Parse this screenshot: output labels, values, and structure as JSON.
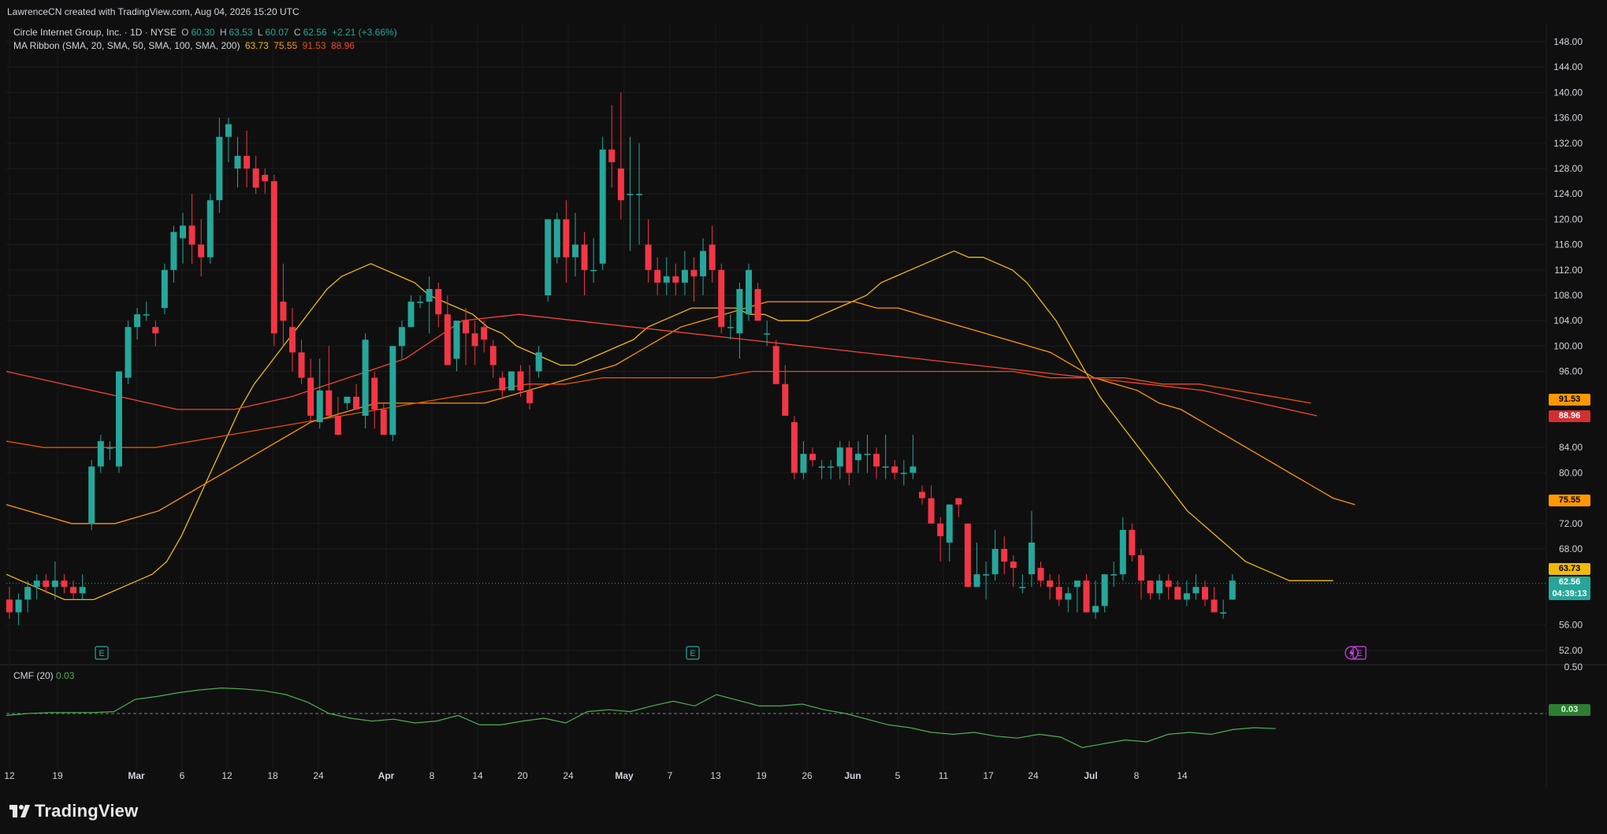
{
  "header": {
    "credit": "LawrenceCN created with TradingView.com, Aug 04, 2026 15:20 UTC"
  },
  "symbol_legend": {
    "name": "Circle Internet Group, Inc. · 1D · NYSE",
    "open_label": "O",
    "open": "60.30",
    "high_label": "H",
    "high": "63.53",
    "low_label": "L",
    "low": "60.07",
    "close_label": "C",
    "close": "62.56",
    "change": "+2.21 (+3.66%)"
  },
  "ma_legend": {
    "name": "MA Ribbon (SMA, 20, SMA, 50, SMA, 100, SMA, 200)",
    "values": [
      "63.73",
      "75.55",
      "91.53",
      "88.96"
    ]
  },
  "cmf_legend": {
    "name": "CMF (20)",
    "value": "0.03"
  },
  "price_axis": {
    "ticks": [
      "148.00",
      "144.00",
      "140.00",
      "136.00",
      "132.00",
      "128.00",
      "124.00",
      "120.00",
      "116.00",
      "112.00",
      "108.00",
      "104.00",
      "100.00",
      "96.00",
      "84.00",
      "80.00",
      "72.00",
      "68.00",
      "56.00",
      "52.00"
    ],
    "cmf_tick": "0.50"
  },
  "price_labels": {
    "ma200": "91.53",
    "ma100": "88.96",
    "ma50": "75.55",
    "ma20": "63.73",
    "last": "62.56",
    "countdown": "04:39:13",
    "cmf": "0.03"
  },
  "time_axis": [
    "12",
    "19",
    "Mar",
    "6",
    "12",
    "18",
    "24",
    "Apr",
    "8",
    "14",
    "20",
    "24",
    "May",
    "7",
    "13",
    "19",
    "26",
    "Jun",
    "5",
    "11",
    "17",
    "24",
    "Jul",
    "8",
    "14"
  ],
  "earnings_markers": [
    "E",
    "E",
    "E"
  ],
  "brand": {
    "logo_text": "TradingView"
  },
  "colors": {
    "background": "#0f0f0f",
    "up": "#26a69a",
    "down": "#f23645",
    "ma20": "#f0b90b",
    "ma50": "#ff9800",
    "ma100": "#e65100",
    "ma200": "#f44336",
    "cmf_line": "#4caf50"
  },
  "chart_data": [
    {
      "type": "candlestick",
      "title": "Circle Internet Group, Inc. · 1D · NYSE",
      "ylim": [
        50,
        150
      ],
      "xlabel": "",
      "ylabel": "",
      "grid": true,
      "date_ticks": [
        "12",
        "19",
        "Mar",
        "6",
        "12",
        "18",
        "24",
        "Apr",
        "8",
        "14",
        "20",
        "24",
        "May",
        "7",
        "13",
        "19",
        "26",
        "Jun",
        "5",
        "11",
        "17",
        "24",
        "Jul",
        "8",
        "14"
      ],
      "candles": [
        [
          60,
          62,
          57,
          58
        ],
        [
          58,
          61,
          56,
          60
        ],
        [
          60,
          63,
          58,
          62
        ],
        [
          62,
          64,
          60,
          63
        ],
        [
          63,
          64,
          61,
          62
        ],
        [
          62,
          66,
          60,
          63
        ],
        [
          63,
          64,
          61,
          62
        ],
        [
          62,
          63,
          60,
          61
        ],
        [
          61,
          64,
          60,
          62
        ],
        [
          72,
          82,
          71,
          81
        ],
        [
          81,
          86,
          80,
          85
        ],
        [
          84,
          85,
          82,
          84
        ],
        [
          81,
          95,
          80,
          96
        ],
        [
          95,
          104,
          94,
          103
        ],
        [
          103,
          106,
          101,
          105
        ],
        [
          105,
          107,
          104,
          105
        ],
        [
          103,
          104,
          100,
          102
        ],
        [
          106,
          113,
          105,
          112
        ],
        [
          112,
          119,
          110,
          118
        ],
        [
          117,
          121,
          113,
          119
        ],
        [
          119,
          124,
          113,
          116
        ],
        [
          116,
          120,
          111,
          114
        ],
        [
          114,
          124,
          113,
          123
        ],
        [
          123,
          136,
          121,
          133
        ],
        [
          133,
          136,
          129,
          135
        ],
        [
          128,
          133,
          125,
          130
        ],
        [
          130,
          134,
          125,
          128
        ],
        [
          128,
          130,
          124,
          125
        ],
        [
          127,
          128,
          124,
          126
        ],
        [
          126,
          127,
          100,
          102
        ],
        [
          107,
          113,
          100,
          104
        ],
        [
          103,
          106,
          96,
          99
        ],
        [
          99,
          101,
          94,
          95
        ],
        [
          95,
          98,
          88,
          89
        ],
        [
          88,
          98,
          87,
          93
        ],
        [
          93,
          100,
          89,
          89
        ],
        [
          89,
          92,
          86,
          86
        ],
        [
          91,
          92,
          90,
          92
        ],
        [
          92,
          94,
          90,
          90
        ],
        [
          89,
          102,
          87,
          101
        ],
        [
          95,
          96,
          87,
          90
        ],
        [
          90,
          91,
          86,
          86
        ],
        [
          86,
          99,
          85,
          100
        ],
        [
          100,
          104,
          98,
          103
        ],
        [
          103,
          108,
          103,
          107
        ],
        [
          107,
          108,
          106,
          107
        ],
        [
          107,
          111,
          102,
          109
        ],
        [
          109,
          110,
          103,
          105
        ],
        [
          105,
          108,
          99,
          97
        ],
        [
          98,
          103,
          96,
          104
        ],
        [
          104,
          106,
          97,
          102
        ],
        [
          102,
          104,
          97,
          100
        ],
        [
          103,
          104,
          99,
          101
        ],
        [
          100,
          101,
          95,
          97
        ],
        [
          95,
          96,
          92,
          93
        ],
        [
          93,
          96,
          93,
          96
        ],
        [
          96,
          97,
          92,
          93
        ],
        [
          93,
          97,
          90,
          91
        ],
        [
          96,
          100,
          95,
          99
        ],
        [
          108,
          119,
          107,
          120
        ],
        [
          114,
          121,
          113,
          120
        ],
        [
          120,
          123,
          110,
          114
        ],
        [
          114,
          121,
          111,
          116
        ],
        [
          116,
          118,
          108,
          112
        ],
        [
          112,
          117,
          110,
          112
        ],
        [
          113,
          133,
          112,
          131
        ],
        [
          131,
          138,
          125,
          129
        ],
        [
          128,
          140,
          120,
          123
        ],
        [
          124,
          133,
          115,
          124
        ],
        [
          124,
          132,
          116,
          124
        ],
        [
          116,
          120,
          110,
          112
        ],
        [
          112,
          114,
          108,
          110
        ],
        [
          110,
          114,
          108,
          111
        ],
        [
          111,
          113,
          108,
          110
        ],
        [
          110,
          115,
          108,
          112
        ],
        [
          112,
          114,
          107,
          111
        ],
        [
          111,
          117,
          108,
          115
        ],
        [
          116,
          119,
          110,
          112
        ],
        [
          112,
          113,
          102,
          103
        ],
        [
          103,
          105,
          101,
          103
        ],
        [
          102,
          110,
          98,
          109
        ],
        [
          105,
          113,
          104,
          112
        ],
        [
          109,
          110,
          104,
          104
        ],
        [
          102,
          104,
          100,
          102
        ],
        [
          100,
          101,
          94,
          94
        ],
        [
          94,
          97,
          89,
          89
        ],
        [
          88,
          89,
          79,
          80
        ],
        [
          80,
          85,
          79,
          83
        ],
        [
          83,
          84,
          81,
          82
        ],
        [
          81,
          82,
          79,
          81
        ],
        [
          81,
          82,
          79,
          81
        ],
        [
          81,
          85,
          79,
          84
        ],
        [
          84,
          85,
          78,
          80
        ],
        [
          82,
          85,
          80,
          83
        ],
        [
          83,
          86,
          80,
          83
        ],
        [
          83,
          84,
          79,
          81
        ],
        [
          81,
          86,
          79,
          81
        ],
        [
          81,
          82,
          79,
          80
        ],
        [
          80,
          82,
          78,
          80
        ],
        [
          80,
          86,
          79,
          81
        ],
        [
          77,
          78,
          75,
          76
        ],
        [
          76,
          78,
          72,
          72
        ],
        [
          72,
          73,
          66,
          70
        ],
        [
          69,
          75,
          66,
          75
        ],
        [
          76,
          76,
          73,
          75
        ],
        [
          72,
          72,
          63,
          62
        ],
        [
          62,
          69,
          62,
          64
        ],
        [
          64,
          66,
          60,
          64
        ],
        [
          64,
          71,
          63,
          68
        ],
        [
          68,
          70,
          64,
          66
        ],
        [
          66,
          67,
          62,
          65
        ],
        [
          62,
          64,
          61,
          62
        ],
        [
          64,
          74,
          62,
          69
        ],
        [
          65,
          66,
          62,
          63
        ],
        [
          63,
          64,
          60,
          62
        ],
        [
          62,
          64,
          59,
          60
        ],
        [
          60,
          62,
          58,
          61
        ],
        [
          62,
          63,
          58,
          63
        ],
        [
          63,
          64,
          59,
          58
        ],
        [
          58,
          63,
          57,
          59
        ],
        [
          59,
          63,
          58,
          64
        ],
        [
          64,
          66,
          62,
          64
        ],
        [
          64,
          73,
          63,
          71
        ],
        [
          71,
          72,
          66,
          67
        ],
        [
          67,
          68,
          60,
          63
        ],
        [
          63,
          63,
          60,
          61
        ],
        [
          61,
          64,
          60,
          63
        ],
        [
          63,
          64,
          60,
          62
        ],
        [
          62,
          63,
          60,
          60
        ],
        [
          60,
          63,
          59,
          61
        ],
        [
          61,
          64,
          60,
          62
        ],
        [
          62,
          63,
          59,
          60
        ],
        [
          60,
          62,
          58,
          58
        ],
        [
          58,
          60,
          57,
          58
        ],
        [
          60,
          64,
          60,
          63
        ]
      ],
      "series": [
        {
          "name": "MA 20",
          "x_start_index": 0,
          "values": [
            64,
            63,
            62,
            61,
            60,
            60,
            60,
            61,
            62,
            63,
            64,
            66,
            70,
            75,
            80,
            85,
            90,
            94,
            97,
            100,
            103,
            106,
            109,
            111,
            112,
            113,
            112,
            111,
            110,
            108,
            107,
            106,
            105,
            103,
            102,
            100,
            99,
            98,
            97,
            97,
            98,
            99,
            100,
            101,
            103,
            104,
            105,
            106,
            106,
            106,
            106,
            105,
            105,
            104,
            104,
            104,
            105,
            106,
            107,
            108,
            110,
            111,
            112,
            113,
            114,
            115,
            114,
            114,
            113,
            112,
            110,
            107,
            104,
            100,
            96,
            92,
            89,
            86,
            83,
            80,
            77,
            74,
            72,
            70,
            68,
            66,
            65,
            64,
            63,
            63,
            63,
            63
          ]
        },
        {
          "name": "MA 50",
          "x_start_index": 0,
          "values": [
            75,
            74,
            73,
            72,
            72,
            72,
            73,
            74,
            76,
            78,
            80,
            82,
            84,
            86,
            88,
            89,
            90,
            91,
            91,
            91,
            91,
            91,
            91,
            92,
            93,
            94,
            95,
            96,
            97,
            99,
            101,
            103,
            104,
            105,
            106,
            107,
            107,
            107,
            107,
            107,
            106,
            106,
            105,
            104,
            103,
            102,
            101,
            100,
            99,
            97,
            95,
            94,
            93,
            91,
            90,
            88,
            86,
            84,
            82,
            80,
            78,
            76,
            75
          ]
        },
        {
          "name": "MA 100",
          "x_start_index": 0,
          "values": [
            85,
            84,
            84,
            84,
            84,
            85,
            86,
            87,
            88,
            89,
            90,
            91,
            92,
            93,
            94,
            94,
            95,
            95,
            95,
            95,
            96,
            96,
            96,
            96,
            96,
            96,
            96,
            96,
            95,
            95,
            95,
            94,
            94,
            93,
            92,
            91
          ]
        },
        {
          "name": "MA 200",
          "x_start_index": 0,
          "values": [
            96,
            94,
            92,
            90,
            90,
            92,
            95,
            98,
            104,
            105,
            104,
            103,
            102,
            101,
            100,
            99,
            98,
            97,
            96,
            95,
            94,
            93,
            91,
            89
          ]
        }
      ]
    },
    {
      "type": "line",
      "title": "CMF (20)",
      "ylim": [
        -0.5,
        0.5
      ],
      "series": [
        {
          "name": "CMF (20)",
          "values": [
            -0.02,
            0.0,
            0.01,
            0.01,
            0.01,
            0.02,
            0.15,
            0.18,
            0.22,
            0.25,
            0.27,
            0.26,
            0.24,
            0.2,
            0.12,
            0.0,
            -0.05,
            -0.08,
            -0.06,
            -0.1,
            -0.08,
            -0.02,
            -0.12,
            -0.12,
            -0.08,
            -0.05,
            -0.1,
            0.02,
            0.04,
            0.02,
            0.08,
            0.13,
            0.08,
            0.2,
            0.14,
            0.08,
            0.08,
            0.1,
            0.04,
            0.0,
            -0.06,
            -0.12,
            -0.15,
            -0.2,
            -0.22,
            -0.2,
            -0.24,
            -0.26,
            -0.22,
            -0.25,
            -0.36,
            -0.32,
            -0.28,
            -0.3,
            -0.22,
            -0.2,
            -0.22,
            -0.17,
            -0.15,
            -0.16
          ]
        }
      ]
    }
  ]
}
